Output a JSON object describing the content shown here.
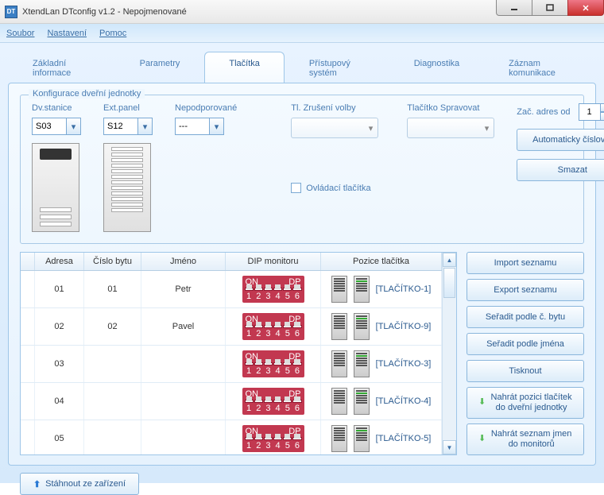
{
  "window": {
    "title": "XtendLan DTconfig v1.2 - Nepojmenované"
  },
  "menu": {
    "file": "Soubor",
    "settings": "Nastavení",
    "help": "Pomoc"
  },
  "tabs": {
    "basic": "Základní informace",
    "params": "Parametry",
    "buttons": "Tlačítka",
    "access": "Přístupový systém",
    "diag": "Diagnostika",
    "comm": "Záznam komunikace"
  },
  "fieldset": {
    "legend": "Konfigurace dveřní jednotky",
    "dvstanice_label": "Dv.stanice",
    "dvstanice_value": "S03",
    "extpanel_label": "Ext.panel",
    "extpanel_value": "S12",
    "nepodporovane_label": "Nepodporované",
    "nepodporovane_value": "---",
    "tl_zruseni": "Tl. Zrušení volby",
    "tl_spravovat": "Tlačítko Spravovat",
    "ovladaci": "Ovládací tlačítka",
    "zac_adres": "Zač. adres od",
    "zac_adres_value": "1",
    "auto_cislovat": "Automaticky číslovat",
    "smazat": "Smazat"
  },
  "grid": {
    "headers": {
      "adresa": "Adresa",
      "cislo": "Číslo bytu",
      "jmeno": "Jméno",
      "dip": "DIP monitoru",
      "pozice": "Pozice tlačítka"
    },
    "rows": [
      {
        "adresa": "01",
        "cislo": "01",
        "jmeno": "Petr",
        "pozice": "[TLAČÍTKO-1]"
      },
      {
        "adresa": "02",
        "cislo": "02",
        "jmeno": "Pavel",
        "pozice": "[TLAČÍTKO-9]"
      },
      {
        "adresa": "03",
        "cislo": "",
        "jmeno": "",
        "pozice": "[TLAČÍTKO-3]"
      },
      {
        "adresa": "04",
        "cislo": "",
        "jmeno": "",
        "pozice": "[TLAČÍTKO-4]"
      },
      {
        "adresa": "05",
        "cislo": "",
        "jmeno": "",
        "pozice": "[TLAČÍTKO-5]"
      }
    ],
    "dip": {
      "on": "ON",
      "dp": "DP",
      "nums": [
        "1",
        "2",
        "3",
        "4",
        "5",
        "6"
      ]
    }
  },
  "side": {
    "import": "Import seznamu",
    "export": "Export seznamu",
    "sort_byt": "Seřadit podle č. bytu",
    "sort_jmeno": "Seřadit podle jména",
    "tisk": "Tisknout",
    "nahrat_pozici": "Nahrát pozici tlačítek do dveřní jednotky",
    "nahrat_seznam": "Nahrát seznam jmen do monitorů"
  },
  "footer": {
    "download": "Stáhnout ze zařízení"
  }
}
